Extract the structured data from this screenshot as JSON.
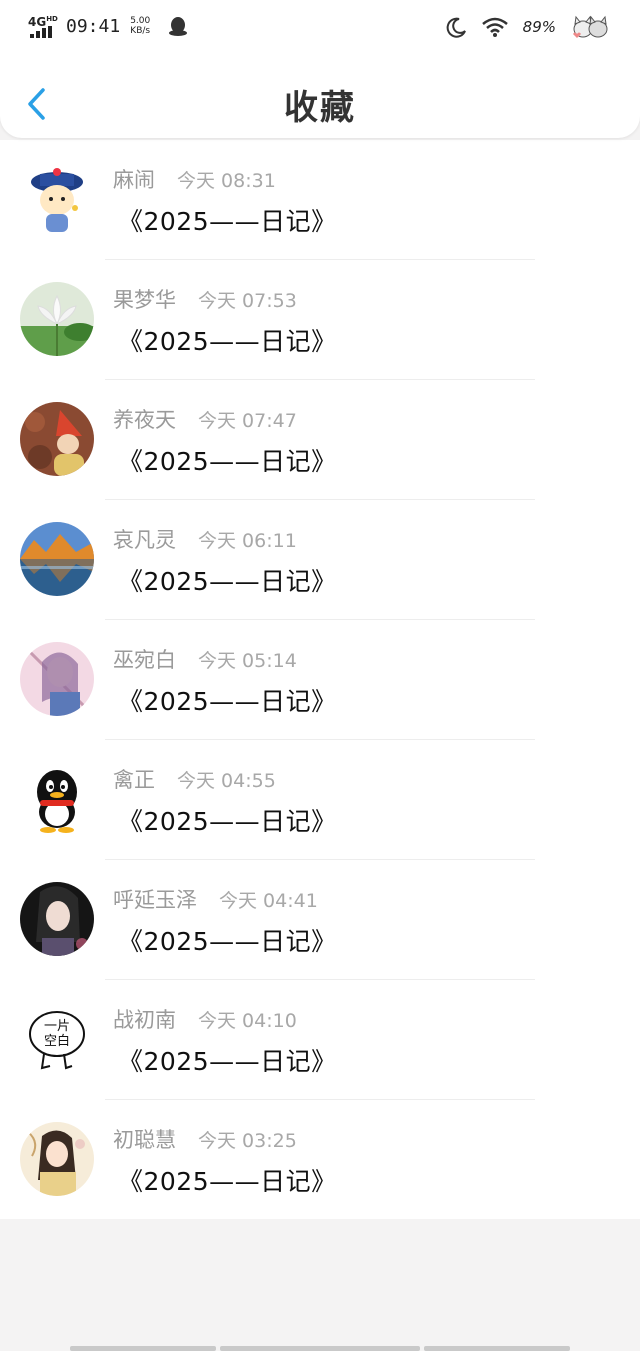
{
  "status": {
    "network": "4G",
    "network_sup": "HD",
    "time": "09:41",
    "speed_value": "5.00",
    "speed_unit": "KB/s",
    "battery": "89%"
  },
  "header": {
    "title": "收藏"
  },
  "items": [
    {
      "name": "麻闹",
      "time": "今天 08:31",
      "title": "《2025——日记》",
      "avatar": "cartoon-official-avatar"
    },
    {
      "name": "果梦华",
      "time": "今天 07:53",
      "title": "《2025——日记》",
      "avatar": "lotus-avatar"
    },
    {
      "name": "养夜天",
      "time": "今天 07:47",
      "title": "《2025——日记》",
      "avatar": "child-autumn-avatar"
    },
    {
      "name": "哀凡灵",
      "time": "今天 06:11",
      "title": "《2025——日记》",
      "avatar": "mountain-lake-avatar"
    },
    {
      "name": "巫宛白",
      "time": "今天 05:14",
      "title": "《2025——日记》",
      "avatar": "anime-girl-avatar"
    },
    {
      "name": "禽正",
      "time": "今天 04:55",
      "title": "《2025——日记》",
      "avatar": "qq-penguin-avatar"
    },
    {
      "name": "呼延玉泽",
      "time": "今天 04:41",
      "title": "《2025——日记》",
      "avatar": "woman-portrait-avatar"
    },
    {
      "name": "战初南",
      "time": "今天 04:10",
      "title": "《2025——日记》",
      "avatar": "blank-sticker-avatar",
      "avatar_text": "一片空白"
    },
    {
      "name": "初聪慧",
      "time": "今天 03:25",
      "title": "《2025——日记》",
      "avatar": "ancient-costume-avatar"
    }
  ],
  "colors": {
    "accent": "#2aa0e6",
    "name_gray": "#9a9a9a",
    "text": "#111111",
    "page_bg": "#f4f3f3"
  }
}
